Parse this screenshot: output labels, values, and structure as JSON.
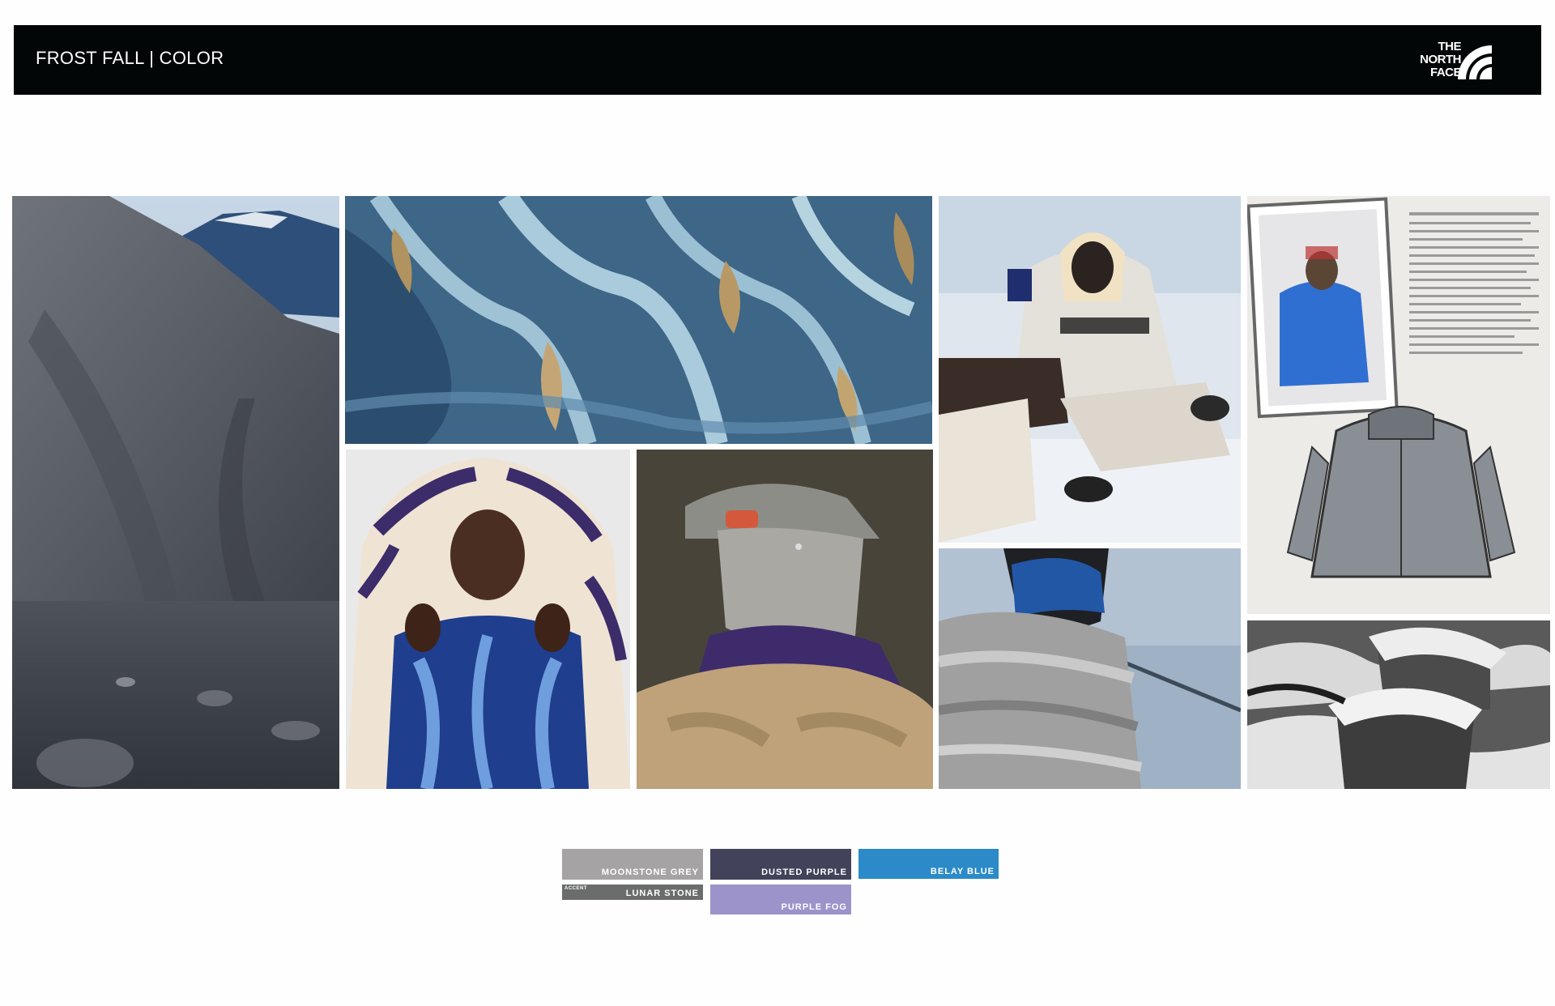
{
  "header": {
    "title": "FROST FALL | COLOR",
    "logo_text": "THE NORTH FACE",
    "logo_icon": "half-dome-logo-icon"
  },
  "photos": [
    {
      "name": "mountain-slope-photo",
      "icon": "landscape-image"
    },
    {
      "name": "glacial-river-aerial-photo",
      "icon": "aerial-image"
    },
    {
      "name": "woman-white-puffer-snow-photo",
      "icon": "portrait-image"
    },
    {
      "name": "vintage-catalog-jacket-photo",
      "icon": "catalog-image"
    },
    {
      "name": "man-striped-fleece-hood-photo",
      "icon": "portrait-image"
    },
    {
      "name": "masked-figure-sherpa-photo",
      "icon": "portrait-image"
    },
    {
      "name": "balaclava-silver-puffer-photo",
      "icon": "portrait-image"
    },
    {
      "name": "snow-covered-cabins-photo",
      "icon": "landscape-image"
    }
  ],
  "swatches": [
    {
      "label": "MOONSTONE GREY",
      "color": "#a5a3a4"
    },
    {
      "label": "DUSTED PURPLE",
      "color": "#42425a"
    },
    {
      "label": "BELAY BLUE",
      "color": "#2b8ac7"
    },
    {
      "label": "LUNAR STONE",
      "tag": "ACCENT",
      "color": "#6b6c6c"
    },
    {
      "label": "PURPLE FOG",
      "color": "#9b93c9"
    }
  ]
}
